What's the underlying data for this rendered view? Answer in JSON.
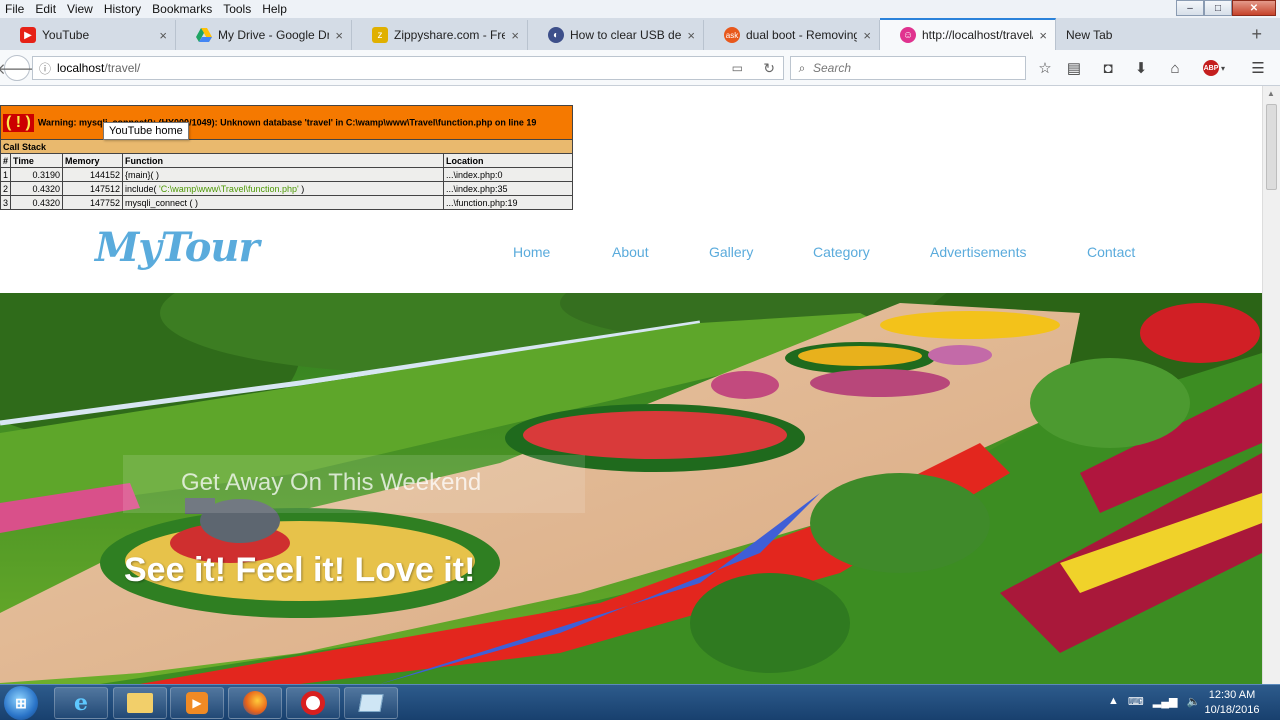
{
  "menu": [
    "File",
    "Edit",
    "View",
    "History",
    "Bookmarks",
    "Tools",
    "Help"
  ],
  "window_controls": {
    "minimize": "–",
    "maximize": "□",
    "close": "✕"
  },
  "tabs": [
    {
      "label": "YouTube",
      "icon": "youtube-icon",
      "color": "#e62117"
    },
    {
      "label": "My Drive - Google Drive",
      "icon": "google-drive-icon",
      "color": "#1fa463"
    },
    {
      "label": "Zippyshare.com - Free...",
      "icon": "zippyshare-icon",
      "color": "#e0b000"
    },
    {
      "label": "How to clear USB devi...",
      "icon": "site-icon",
      "color": "#3d4f8a"
    },
    {
      "label": "dual boot - Removing...",
      "icon": "askubuntu-icon",
      "color": "#e8581c"
    },
    {
      "label": "http://localhost/travel/",
      "icon": "localhost-icon",
      "color": "#e0338f",
      "active": true
    },
    {
      "label": "New Tab",
      "icon": "",
      "color": "",
      "newtab": true
    }
  ],
  "tab_close": "×",
  "tab_add": "+",
  "url": {
    "host": "localhost",
    "path": "/travel/"
  },
  "search": {
    "placeholder": "Search"
  },
  "error": {
    "bang": "( ! )",
    "message": "Warning: mysqli_connect(): (HY000/1049): Unknown database 'travel' in C:\\wamp\\www\\Travel\\function.php on line 19",
    "callstack": "Call Stack",
    "headers": [
      "#",
      "Time",
      "Memory",
      "Function",
      "Location"
    ],
    "rows": [
      {
        "n": "1",
        "time": "0.3190",
        "mem": "144152",
        "fn": "{main}( )",
        "arg": "",
        "loc": "...\\index.php:0"
      },
      {
        "n": "2",
        "time": "0.4320",
        "mem": "147512",
        "fn": "include( ",
        "arg": "'C:\\wamp\\www\\Travel\\function.php'",
        "fnend": " )",
        "loc": "...\\index.php:35"
      },
      {
        "n": "3",
        "time": "0.4320",
        "mem": "147752",
        "fn": "mysqli_connect ( )",
        "arg": "",
        "loc": "...\\function.php:19"
      }
    ]
  },
  "tooltip": "YouTube home",
  "site": {
    "logo": "MyTour",
    "nav": [
      "Home",
      "About",
      "Gallery",
      "Category",
      "Advertisements",
      "Contact"
    ],
    "tagline_small": "Get Away On This Weekend",
    "tagline_big": "See it! Feel it! Love it!"
  },
  "taskbar": {
    "items": [
      "internet-explorer-icon",
      "file-explorer-icon",
      "media-player-icon",
      "firefox-icon",
      "recorder-icon",
      "app-icon"
    ],
    "time": "12:30 AM",
    "date": "10/18/2016"
  }
}
